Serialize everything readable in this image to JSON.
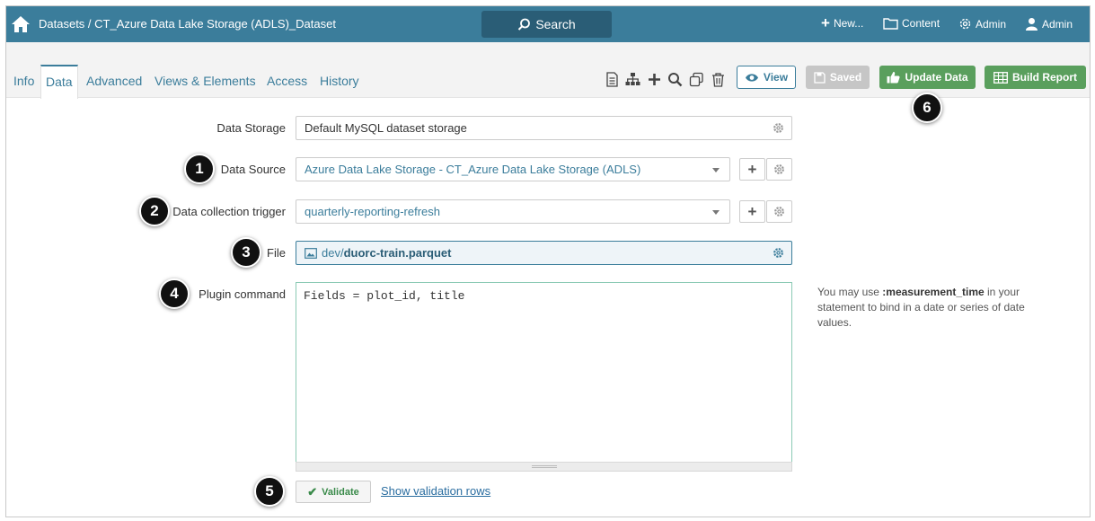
{
  "topbar": {
    "breadcrumb_root": "Datasets",
    "breadcrumb_sep": " / ",
    "breadcrumb_current": "CT_Azure Data Lake Storage (ADLS)_Dataset",
    "search_label": "Search",
    "new_label": "New...",
    "content_label": "Content",
    "admin_menu_label": "Admin",
    "user_label": "Admin"
  },
  "tabs": {
    "info": "Info",
    "data": "Data",
    "advanced": "Advanced",
    "views": "Views & Elements",
    "access": "Access",
    "history": "History"
  },
  "toolbar": {
    "view_label": "View",
    "saved_label": "Saved",
    "update_label": "Update Data",
    "build_label": "Build Report"
  },
  "form": {
    "data_storage_label": "Data Storage",
    "data_storage_value": "Default MySQL dataset storage",
    "data_source_label": "Data Source",
    "data_source_value": "Azure Data Lake Storage - CT_Azure Data Lake Storage (ADLS)",
    "trigger_label": "Data collection trigger",
    "trigger_value": "quarterly-reporting-refresh",
    "file_label": "File",
    "file_folder": "dev",
    "file_sep": " / ",
    "file_name": "duorc-train.parquet",
    "plugin_label": "Plugin command",
    "plugin_value": "Fields = plot_id, title",
    "hint_prefix": "You may use ",
    "hint_bold": ":measurement_time",
    "hint_suffix": " in your statement to bind in a date or series of date values.",
    "validate_label": "Validate",
    "show_rows_label": "Show validation rows"
  },
  "callouts": {
    "c1": "1",
    "c2": "2",
    "c3": "3",
    "c4": "4",
    "c5": "5",
    "c6": "6"
  },
  "colors": {
    "header_bg": "#3b7d9b",
    "accent": "#3b7d9b",
    "button_green": "#5a9f5d",
    "saved_gray": "#c6c6c6"
  }
}
